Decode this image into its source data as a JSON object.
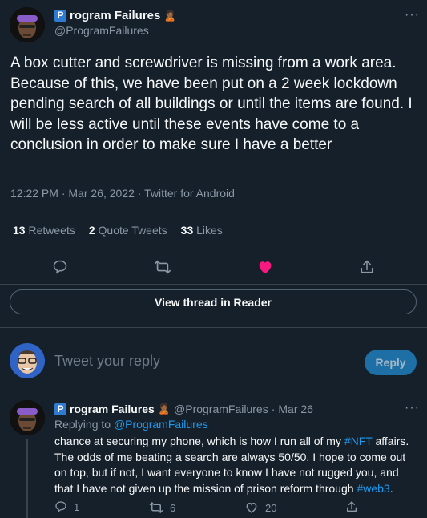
{
  "main_tweet": {
    "display_name": "rogram Failures",
    "badge_letter": "P",
    "handle": "@ProgramFailures",
    "text": "A box cutter and screwdriver is missing from a work area. Because of this, we have been put on a 2 week lockdown pending search of all buildings or until the items are found. I will be less active until these events have come to a conclusion in order to make sure I have a better",
    "time": "12:22 PM",
    "date": "Mar 26, 2022",
    "source": "Twitter for Android",
    "retweets_count": "13",
    "retweets_label": "Retweets",
    "quotes_count": "2",
    "quotes_label": "Quote Tweets",
    "likes_count": "33",
    "likes_label": "Likes"
  },
  "thread_button": "View thread in Reader",
  "reply_box": {
    "placeholder": "Tweet your reply",
    "button": "Reply"
  },
  "reply_tweet": {
    "display_name": "rogram Failures",
    "badge_letter": "P",
    "handle": "@ProgramFailures",
    "date": "Mar 26",
    "replying_prefix": "Replying to",
    "replying_to": "@ProgramFailures",
    "text_1": "chance at securing my phone, which is how I run all of my ",
    "hashtag_1": "#NFT",
    "text_2": " affairs. The odds of me beating a search are always 50/50. I hope to come out on top, but if not, I want everyone to know I have not rugged you, and that I have not given up the mission of prison reform through ",
    "hashtag_2": "#web3",
    "text_3": ".",
    "reply_count": "1",
    "retweet_count": "6",
    "like_count": "20"
  },
  "colors": {
    "background": "#15202b",
    "accent": "#1d9bf0",
    "like": "#f91880"
  }
}
